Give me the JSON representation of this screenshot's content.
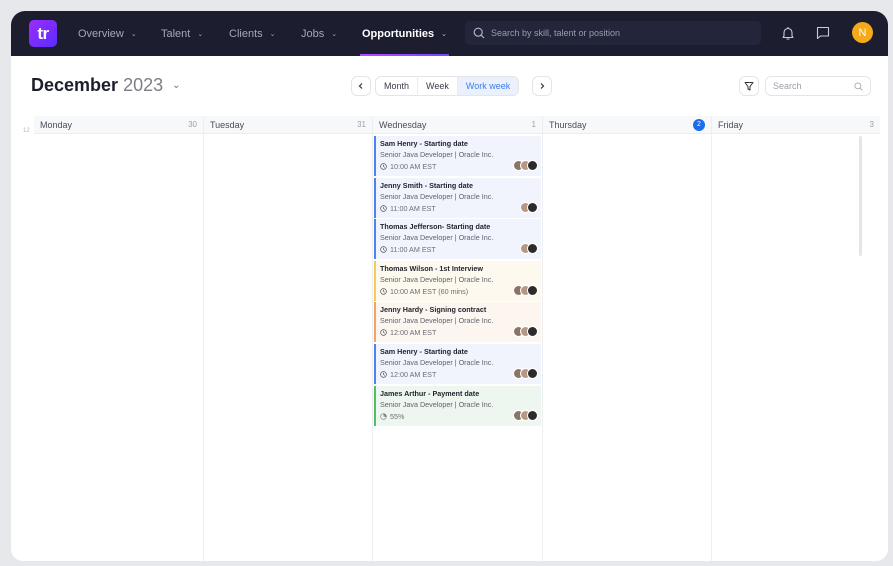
{
  "nav": {
    "logo": "tr",
    "items": [
      {
        "label": "Overview",
        "active": false
      },
      {
        "label": "Talent",
        "active": false
      },
      {
        "label": "Clients",
        "active": false
      },
      {
        "label": "Jobs",
        "active": false
      },
      {
        "label": "Opportunities",
        "active": true
      }
    ],
    "search_placeholder": "Search by skill, talent or position",
    "user_initial": "N",
    "icons": [
      "bell-icon",
      "chat-icon"
    ]
  },
  "toolbar": {
    "month": "December",
    "year": "2023",
    "views": [
      "Month",
      "Week",
      "Work week"
    ],
    "active_view": "Work week",
    "search_placeholder": "Search"
  },
  "calendar": {
    "hour_label": "12",
    "days": [
      {
        "name": "Monday",
        "date": "30",
        "today": false
      },
      {
        "name": "Tuesday",
        "date": "31",
        "today": false
      },
      {
        "name": "Wednesday",
        "date": "1",
        "today": false
      },
      {
        "name": "Thursday",
        "date": "2",
        "today": true
      },
      {
        "name": "Friday",
        "date": "3",
        "today": false
      }
    ],
    "events": [
      {
        "title": "Sam Henry - Starting date",
        "subtitle": "Senior Java Developer | Oracle Inc.",
        "meta": "10:00 AM EST",
        "meta_icon": "clock-icon",
        "color": "blue",
        "faces": 3
      },
      {
        "title": "Jenny Smith - Starting date",
        "subtitle": "Senior Java Developer | Oracle Inc.",
        "meta": "11:00 AM EST",
        "meta_icon": "clock-icon",
        "color": "blue",
        "faces": 2
      },
      {
        "title": "Thomas Jefferson- Starting date",
        "subtitle": "Senior Java Developer | Oracle Inc.",
        "meta": "11:00 AM EST",
        "meta_icon": "clock-icon",
        "color": "blue",
        "faces": 2
      },
      {
        "title": "Thomas Wilson - 1st Interview",
        "subtitle": "Senior Java Developer | Oracle Inc.",
        "meta": "10:00 AM EST (60 mins)",
        "meta_icon": "clock-icon",
        "color": "yellow",
        "faces": 3
      },
      {
        "title": "Jenny Hardy - Signing contract",
        "subtitle": "Senior Java Developer | Oracle Inc.",
        "meta": "12:00 AM EST",
        "meta_icon": "clock-icon",
        "color": "orange",
        "faces": 3
      },
      {
        "title": "Sam Henry - Starting date",
        "subtitle": "Senior Java Developer | Oracle Inc.",
        "meta": "12:00 AM EST",
        "meta_icon": "clock-icon",
        "color": "blue",
        "faces": 3
      },
      {
        "title": "James Arthur - Payment date",
        "subtitle": "Senior Java Developer | Oracle Inc.",
        "meta": "55%",
        "meta_icon": "progress-icon",
        "color": "green",
        "faces": 3
      }
    ]
  }
}
